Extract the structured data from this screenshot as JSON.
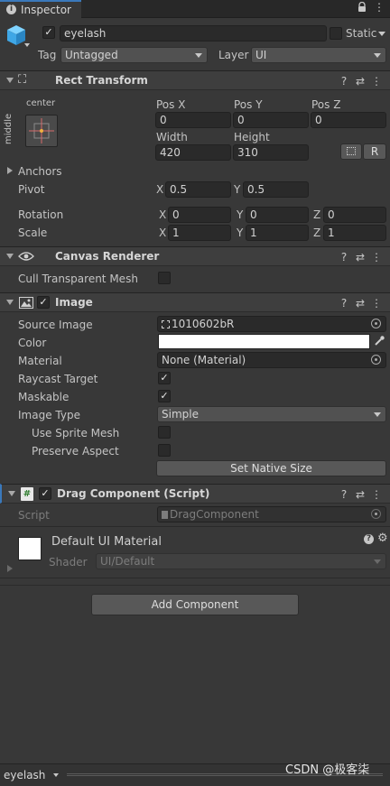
{
  "tab": {
    "label": "Inspector"
  },
  "object": {
    "name": "eyelash",
    "static_label": "Static",
    "tag_label": "Tag",
    "tag_value": "Untagged",
    "layer_label": "Layer",
    "layer_value": "UI"
  },
  "rect_transform": {
    "title": "Rect Transform",
    "anchor_h": "center",
    "anchor_v": "middle",
    "pos_x_label": "Pos X",
    "pos_x": "0",
    "pos_y_label": "Pos Y",
    "pos_y": "0",
    "pos_z_label": "Pos Z",
    "pos_z": "0",
    "width_label": "Width",
    "width": "420",
    "height_label": "Height",
    "height": "310",
    "r_button": "R",
    "anchors_label": "Anchors",
    "pivot_label": "Pivot",
    "pivot_x": "0.5",
    "pivot_y": "0.5",
    "rotation_label": "Rotation",
    "rot_x": "0",
    "rot_y": "0",
    "rot_z": "0",
    "scale_label": "Scale",
    "scale_x": "1",
    "scale_y": "1",
    "scale_z": "1",
    "x": "X",
    "y": "Y",
    "z": "Z"
  },
  "canvas_renderer": {
    "title": "Canvas Renderer",
    "cull_label": "Cull Transparent Mesh"
  },
  "image": {
    "title": "Image",
    "source_image_label": "Source Image",
    "source_image": "1010602bR",
    "color_label": "Color",
    "color_value": "#ffffff",
    "material_label": "Material",
    "material_value": "None (Material)",
    "raycast_label": "Raycast Target",
    "maskable_label": "Maskable",
    "image_type_label": "Image Type",
    "image_type": "Simple",
    "use_sprite_mesh_label": "Use Sprite Mesh",
    "preserve_aspect_label": "Preserve Aspect",
    "set_native_size": "Set Native Size"
  },
  "drag_component": {
    "title": "Drag Component (Script)",
    "script_label": "Script",
    "script_value": "DragComponent"
  },
  "material": {
    "name": "Default UI Material",
    "shader_label": "Shader",
    "shader_value": "UI/Default"
  },
  "add_component": "Add Component",
  "footer": {
    "object_name": "eyelash",
    "watermark": "CSDN @极客柒"
  },
  "colors": {
    "panel_bg": "#383838",
    "header_bg": "#3e3e3e",
    "field_bg": "#2a2a2a",
    "accent_blue": "#3a79bb"
  }
}
